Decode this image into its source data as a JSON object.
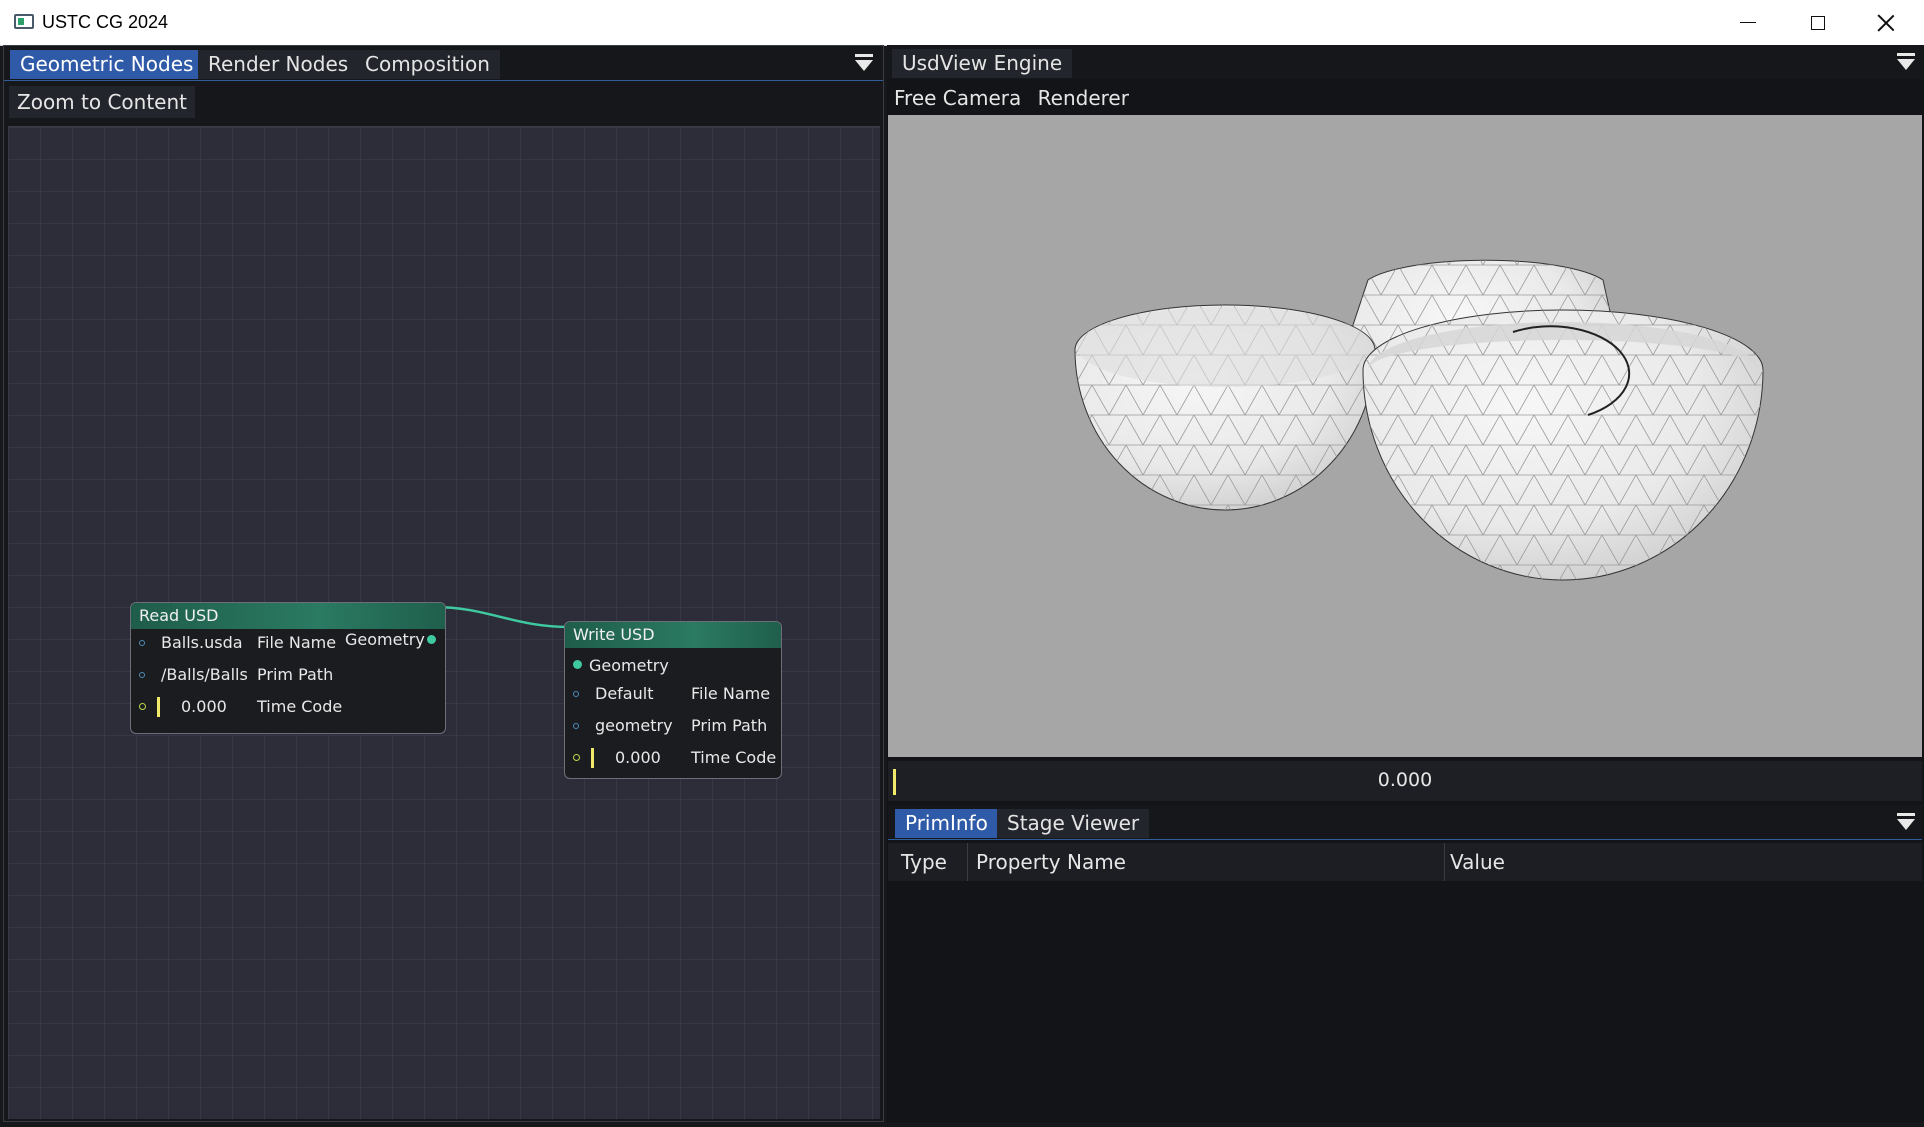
{
  "window": {
    "title": "USTC CG 2024"
  },
  "left_panel": {
    "tabs": [
      "Geometric Nodes",
      "Render Nodes",
      "Composition"
    ],
    "active_tab": "Geometric Nodes",
    "toolbar": {
      "zoom_button": "Zoom to Content"
    },
    "nodes": {
      "read_usd": {
        "title": "Read USD",
        "output": "Geometry",
        "rows": [
          {
            "value": "Balls.usda",
            "label": "File Name"
          },
          {
            "value": "/Balls/Balls",
            "label": "Prim Path"
          },
          {
            "value": "0.000",
            "label": "Time Code"
          }
        ]
      },
      "write_usd": {
        "title": "Write USD",
        "input": "Geometry",
        "rows": [
          {
            "value": "Default",
            "label": "File Name"
          },
          {
            "value": "geometry",
            "label": "Prim Path"
          },
          {
            "value": "0.000",
            "label": "Time Code"
          }
        ]
      }
    }
  },
  "right_panel": {
    "engine_tab": "UsdView Engine",
    "viewport_menu": [
      "Free Camera",
      "Renderer"
    ],
    "timeline": {
      "value": "0.000"
    },
    "bottom_tabs": [
      "PrimInfo",
      "Stage Viewer"
    ],
    "active_bottom_tab": "PrimInfo",
    "table": {
      "columns": [
        "Type",
        "Property Name",
        "Value"
      ],
      "rows": []
    }
  },
  "colors": {
    "accent": "#2e5aa8",
    "node_header": "#2b7a62",
    "link": "#3ec9a0",
    "viewport_bg": "#a6a6a6"
  },
  "icons": [
    "app-icon",
    "minimize-icon",
    "maximize-icon",
    "close-icon",
    "panel-menu-icon"
  ]
}
